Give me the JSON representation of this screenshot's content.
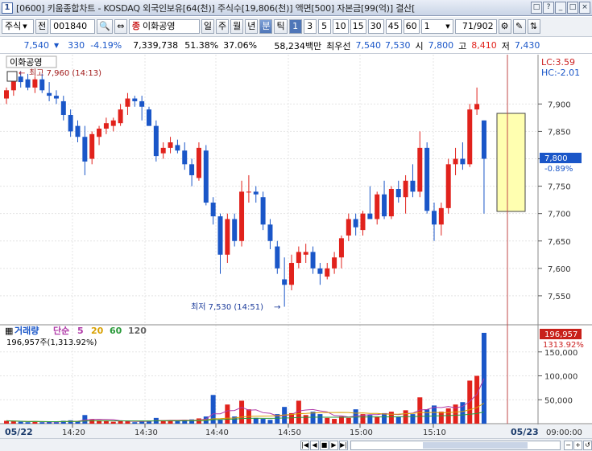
{
  "window": {
    "number": "1",
    "title": "[0600] 키움종합차트 - KOSDAQ 외국인보유[64(천)] 주식수[19,806(천)] 액면[500] 자본금[99(억)] 결산[",
    "buttons": [
      "□",
      "?",
      "_",
      "□",
      "×"
    ]
  },
  "toolbar": {
    "market": "주식",
    "prev_label": "전",
    "code": "001840",
    "stock_name": "이화공영",
    "period_tabs": [
      "일",
      "주",
      "월",
      "년",
      "분",
      "틱"
    ],
    "selected_period": "분",
    "minute_options": [
      "1",
      "3",
      "5",
      "10",
      "15",
      "30",
      "45",
      "60"
    ],
    "selected_minute": "1",
    "interval_value": "1",
    "page_info": "71",
    "page_total": "/902",
    "icon_names": [
      "search-icon",
      "settings-icon",
      "tools-icon",
      "scroll-icon"
    ]
  },
  "infobar": {
    "price": "7,540",
    "change": "330",
    "change_pct": "-4.19%",
    "volume": "7,339,738",
    "ratio1": "51.38%",
    "ratio2": "37.06%",
    "amount": "58,234백만",
    "best_label": "최우선",
    "best_ask": "7,540",
    "best_bid": "7,530",
    "open_label": "시",
    "open": "7,800",
    "high_label": "고",
    "high": "8,410",
    "low_label": "저",
    "low": "7,430"
  },
  "price_panel": {
    "name": "이화공영",
    "high_note": "최고 7,960 (14:13)",
    "low_note": "최저 7,530 (14:51)",
    "lc": "LC:3.59",
    "hc": "HC:-2.01",
    "current_tag": "7,800",
    "current_pct": "-0.89%",
    "y_ticks": [
      "7,900",
      "7,850",
      "7,800",
      "7,750",
      "7,700",
      "7,650",
      "7,600",
      "7,550"
    ]
  },
  "volume_panel": {
    "label": "거래량",
    "ma_label": "단순",
    "ma_periods": [
      "5",
      "20",
      "60",
      "120"
    ],
    "value_line": "196,957주(1,313.92%)",
    "current_tag": "196,957",
    "current_pct": "1313.92%",
    "y_ticks": [
      "150,000",
      "100,000",
      "50,000"
    ]
  },
  "x_axis": {
    "start_label": "05/22",
    "ticks": [
      "14:20",
      "14:30",
      "14:40",
      "14:50",
      "15:00",
      "15:10"
    ],
    "end_label": "05/23",
    "end_time": "09:00:00"
  },
  "colors": {
    "up": "#e1221c",
    "down": "#1a56c8",
    "highlight": "#ffffb0"
  },
  "chart_data": {
    "type": "candlestick",
    "title": "이화공영",
    "y_range": [
      7500,
      7990
    ],
    "candles": [
      {
        "o": 7910,
        "h": 7930,
        "l": 7900,
        "c": 7925
      },
      {
        "o": 7925,
        "h": 7960,
        "l": 7915,
        "c": 7950
      },
      {
        "o": 7950,
        "h": 7960,
        "l": 7930,
        "c": 7940
      },
      {
        "o": 7945,
        "h": 7955,
        "l": 7925,
        "c": 7930
      },
      {
        "o": 7930,
        "h": 7950,
        "l": 7920,
        "c": 7945
      },
      {
        "o": 7945,
        "h": 7955,
        "l": 7920,
        "c": 7925
      },
      {
        "o": 7920,
        "h": 7940,
        "l": 7905,
        "c": 7915
      },
      {
        "o": 7915,
        "h": 7925,
        "l": 7900,
        "c": 7910
      },
      {
        "o": 7905,
        "h": 7915,
        "l": 7870,
        "c": 7880
      },
      {
        "o": 7880,
        "h": 7890,
        "l": 7840,
        "c": 7850
      },
      {
        "o": 7860,
        "h": 7870,
        "l": 7830,
        "c": 7840
      },
      {
        "o": 7840,
        "h": 7860,
        "l": 7770,
        "c": 7795
      },
      {
        "o": 7800,
        "h": 7850,
        "l": 7790,
        "c": 7845
      },
      {
        "o": 7840,
        "h": 7860,
        "l": 7825,
        "c": 7855
      },
      {
        "o": 7855,
        "h": 7875,
        "l": 7845,
        "c": 7865
      },
      {
        "o": 7860,
        "h": 7875,
        "l": 7850,
        "c": 7870
      },
      {
        "o": 7865,
        "h": 7900,
        "l": 7860,
        "c": 7890
      },
      {
        "o": 7895,
        "h": 7920,
        "l": 7880,
        "c": 7910
      },
      {
        "o": 7910,
        "h": 7915,
        "l": 7895,
        "c": 7905
      },
      {
        "o": 7905,
        "h": 7915,
        "l": 7870,
        "c": 7895
      },
      {
        "o": 7890,
        "h": 7895,
        "l": 7860,
        "c": 7860
      },
      {
        "o": 7860,
        "h": 7870,
        "l": 7795,
        "c": 7805
      },
      {
        "o": 7810,
        "h": 7830,
        "l": 7800,
        "c": 7820
      },
      {
        "o": 7820,
        "h": 7840,
        "l": 7810,
        "c": 7830
      },
      {
        "o": 7825,
        "h": 7835,
        "l": 7810,
        "c": 7815
      },
      {
        "o": 7815,
        "h": 7830,
        "l": 7780,
        "c": 7790
      },
      {
        "o": 7790,
        "h": 7800,
        "l": 7750,
        "c": 7770
      },
      {
        "o": 7765,
        "h": 7830,
        "l": 7760,
        "c": 7820
      },
      {
        "o": 7815,
        "h": 7825,
        "l": 7715,
        "c": 7720
      },
      {
        "o": 7720,
        "h": 7730,
        "l": 7680,
        "c": 7695
      },
      {
        "o": 7695,
        "h": 7700,
        "l": 7590,
        "c": 7625
      },
      {
        "o": 7625,
        "h": 7700,
        "l": 7610,
        "c": 7690
      },
      {
        "o": 7690,
        "h": 7700,
        "l": 7640,
        "c": 7650
      },
      {
        "o": 7650,
        "h": 7760,
        "l": 7640,
        "c": 7740
      },
      {
        "o": 7740,
        "h": 7770,
        "l": 7720,
        "c": 7740
      },
      {
        "o": 7740,
        "h": 7750,
        "l": 7720,
        "c": 7735
      },
      {
        "o": 7730,
        "h": 7740,
        "l": 7670,
        "c": 7680
      },
      {
        "o": 7680,
        "h": 7690,
        "l": 7635,
        "c": 7650
      },
      {
        "o": 7640,
        "h": 7650,
        "l": 7590,
        "c": 7600
      },
      {
        "o": 7580,
        "h": 7620,
        "l": 7530,
        "c": 7570
      },
      {
        "o": 7570,
        "h": 7625,
        "l": 7560,
        "c": 7610
      },
      {
        "o": 7610,
        "h": 7640,
        "l": 7600,
        "c": 7630
      },
      {
        "o": 7625,
        "h": 7645,
        "l": 7610,
        "c": 7630
      },
      {
        "o": 7630,
        "h": 7640,
        "l": 7590,
        "c": 7600
      },
      {
        "o": 7600,
        "h": 7610,
        "l": 7570,
        "c": 7590
      },
      {
        "o": 7585,
        "h": 7610,
        "l": 7580,
        "c": 7600
      },
      {
        "o": 7600,
        "h": 7630,
        "l": 7590,
        "c": 7620
      },
      {
        "o": 7620,
        "h": 7660,
        "l": 7600,
        "c": 7655
      },
      {
        "o": 7660,
        "h": 7700,
        "l": 7650,
        "c": 7690
      },
      {
        "o": 7690,
        "h": 7700,
        "l": 7660,
        "c": 7675
      },
      {
        "o": 7670,
        "h": 7705,
        "l": 7660,
        "c": 7700
      },
      {
        "o": 7700,
        "h": 7750,
        "l": 7690,
        "c": 7690
      },
      {
        "o": 7690,
        "h": 7740,
        "l": 7680,
        "c": 7735
      },
      {
        "o": 7735,
        "h": 7760,
        "l": 7690,
        "c": 7695
      },
      {
        "o": 7695,
        "h": 7750,
        "l": 7690,
        "c": 7745
      },
      {
        "o": 7745,
        "h": 7760,
        "l": 7720,
        "c": 7730
      },
      {
        "o": 7730,
        "h": 7770,
        "l": 7700,
        "c": 7760
      },
      {
        "o": 7760,
        "h": 7790,
        "l": 7730,
        "c": 7740
      },
      {
        "o": 7740,
        "h": 7850,
        "l": 7730,
        "c": 7820
      },
      {
        "o": 7820,
        "h": 7830,
        "l": 7700,
        "c": 7705
      },
      {
        "o": 7705,
        "h": 7720,
        "l": 7650,
        "c": 7680
      },
      {
        "o": 7680,
        "h": 7720,
        "l": 7660,
        "c": 7710
      },
      {
        "o": 7710,
        "h": 7800,
        "l": 7700,
        "c": 7790
      },
      {
        "o": 7790,
        "h": 7820,
        "l": 7770,
        "c": 7800
      },
      {
        "o": 7800,
        "h": 7830,
        "l": 7780,
        "c": 7790
      },
      {
        "o": 7790,
        "h": 7900,
        "l": 7785,
        "c": 7890
      },
      {
        "o": 7890,
        "h": 7930,
        "l": 7880,
        "c": 7900
      },
      {
        "o": 7870,
        "h": 7870,
        "l": 7700,
        "c": 7800
      }
    ],
    "volumes": [
      6000,
      5000,
      4000,
      3000,
      5000,
      3000,
      4000,
      3000,
      6000,
      7000,
      5000,
      18000,
      9000,
      7000,
      5000,
      4000,
      6000,
      5000,
      3000,
      5000,
      6000,
      12000,
      7000,
      6000,
      5000,
      8000,
      9000,
      11000,
      15000,
      60000,
      8000,
      40000,
      15000,
      48000,
      30000,
      12000,
      10000,
      8000,
      20000,
      35000,
      22000,
      48000,
      18000,
      25000,
      20000,
      12000,
      10000,
      15000,
      12000,
      30000,
      20000,
      18000,
      15000,
      22000,
      25000,
      15000,
      28000,
      20000,
      55000,
      30000,
      38000,
      25000,
      32000,
      40000,
      45000,
      90000,
      100000,
      196957
    ]
  }
}
